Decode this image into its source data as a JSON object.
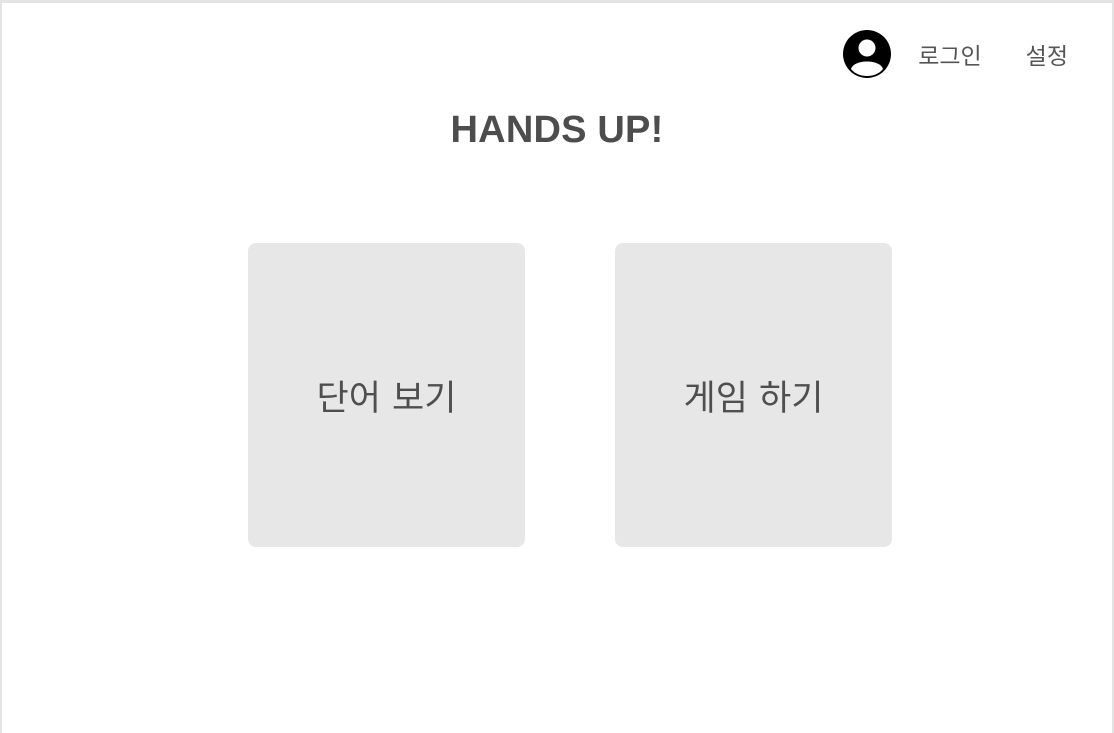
{
  "header": {
    "title": "HANDS UP!",
    "login_label": "로그인",
    "settings_label": "설정",
    "avatar_icon": "user-avatar-icon"
  },
  "menu": {
    "cards": [
      {
        "label": "단어 보기"
      },
      {
        "label": "게임 하기"
      }
    ]
  },
  "colors": {
    "background": "#ffffff",
    "card": "#e7e7e7",
    "text": "#4d4d4d",
    "border": "#e3e3e3",
    "avatar": "#000000"
  }
}
